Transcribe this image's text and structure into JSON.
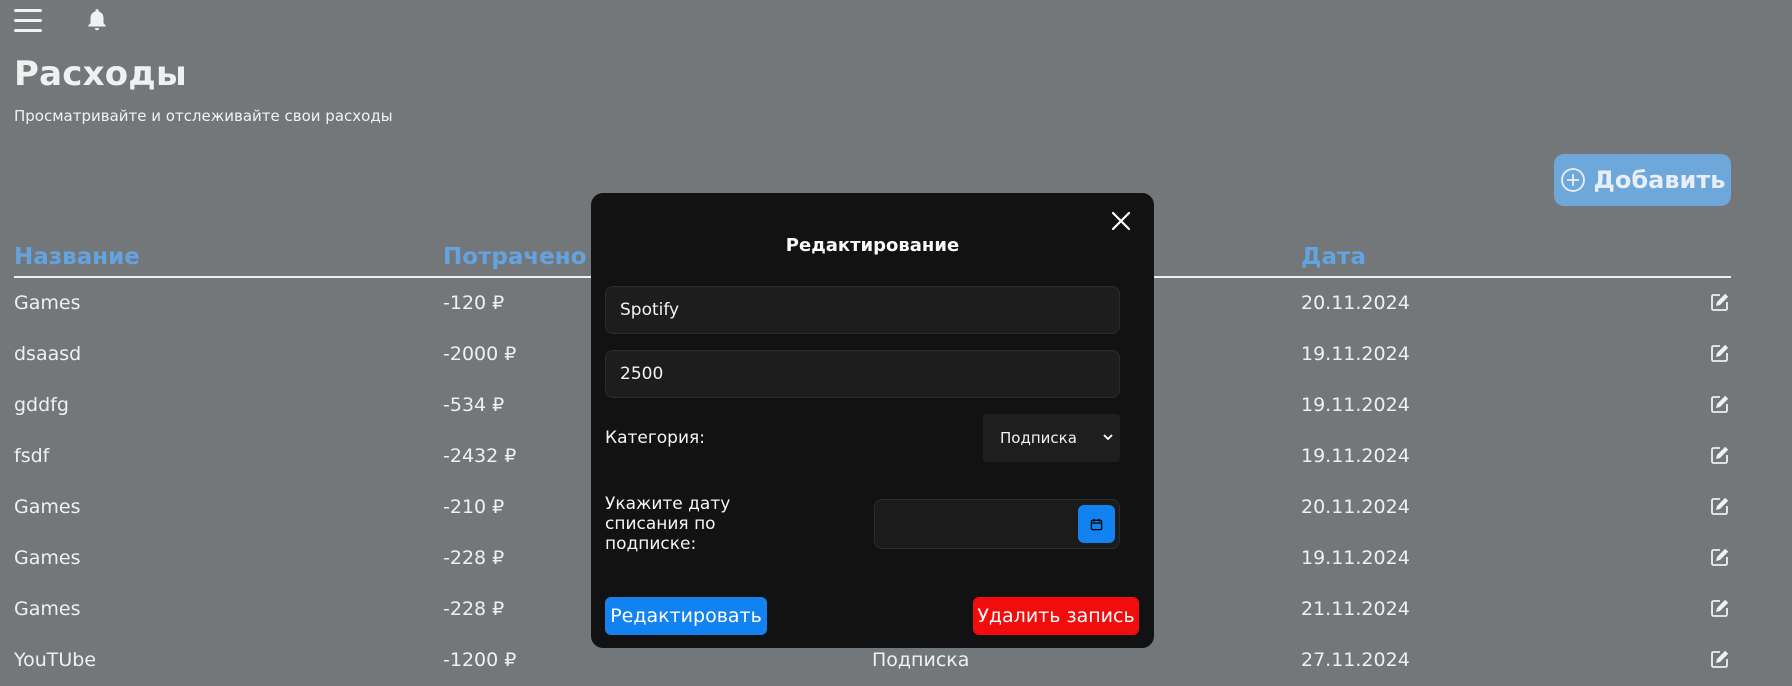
{
  "header": {
    "title": "Расходы",
    "subtitle": "Просматривайте и отслеживайте свои расходы",
    "add_label": "Добавить"
  },
  "table": {
    "columns": [
      "Название",
      "Потрачено",
      "",
      "Дата"
    ],
    "rows": [
      {
        "name": "Games",
        "spent": "-120 ₽",
        "category": "",
        "date": "20.11.2024"
      },
      {
        "name": "dsaasd",
        "spent": "-2000 ₽",
        "category": "",
        "date": "19.11.2024"
      },
      {
        "name": "gddfg",
        "spent": "-534 ₽",
        "category": "",
        "date": "19.11.2024"
      },
      {
        "name": "fsdf",
        "spent": "-2432 ₽",
        "category": "",
        "date": "19.11.2024"
      },
      {
        "name": "Games",
        "spent": "-210 ₽",
        "category": "",
        "date": "20.11.2024"
      },
      {
        "name": "Games",
        "spent": "-228 ₽",
        "category": "",
        "date": "19.11.2024"
      },
      {
        "name": "Games",
        "spent": "-228 ₽",
        "category": "",
        "date": "21.11.2024"
      },
      {
        "name": "YouTUbe",
        "spent": "-1200 ₽",
        "category": "Подписка",
        "date": "27.11.2024"
      }
    ]
  },
  "modal": {
    "title": "Редактирование",
    "name_value": "Spotify",
    "amount_value": "2500",
    "category_label": "Категория:",
    "category_value": "Подписка",
    "date_label": "Укажите дату списания по подписке:",
    "date_value": "",
    "edit_label": "Редактировать",
    "delete_label": "Удалить запись"
  },
  "colors": {
    "accent": "#63a4e0",
    "primary_button": "#1182f0",
    "danger": "#f20c0c",
    "overlay_bg": "#737779",
    "modal_bg": "#121212"
  },
  "icons": [
    "menu-icon",
    "bell-icon",
    "plus-circle-icon",
    "edit-icon",
    "close-icon",
    "chevron-down-icon",
    "calendar-icon"
  ]
}
